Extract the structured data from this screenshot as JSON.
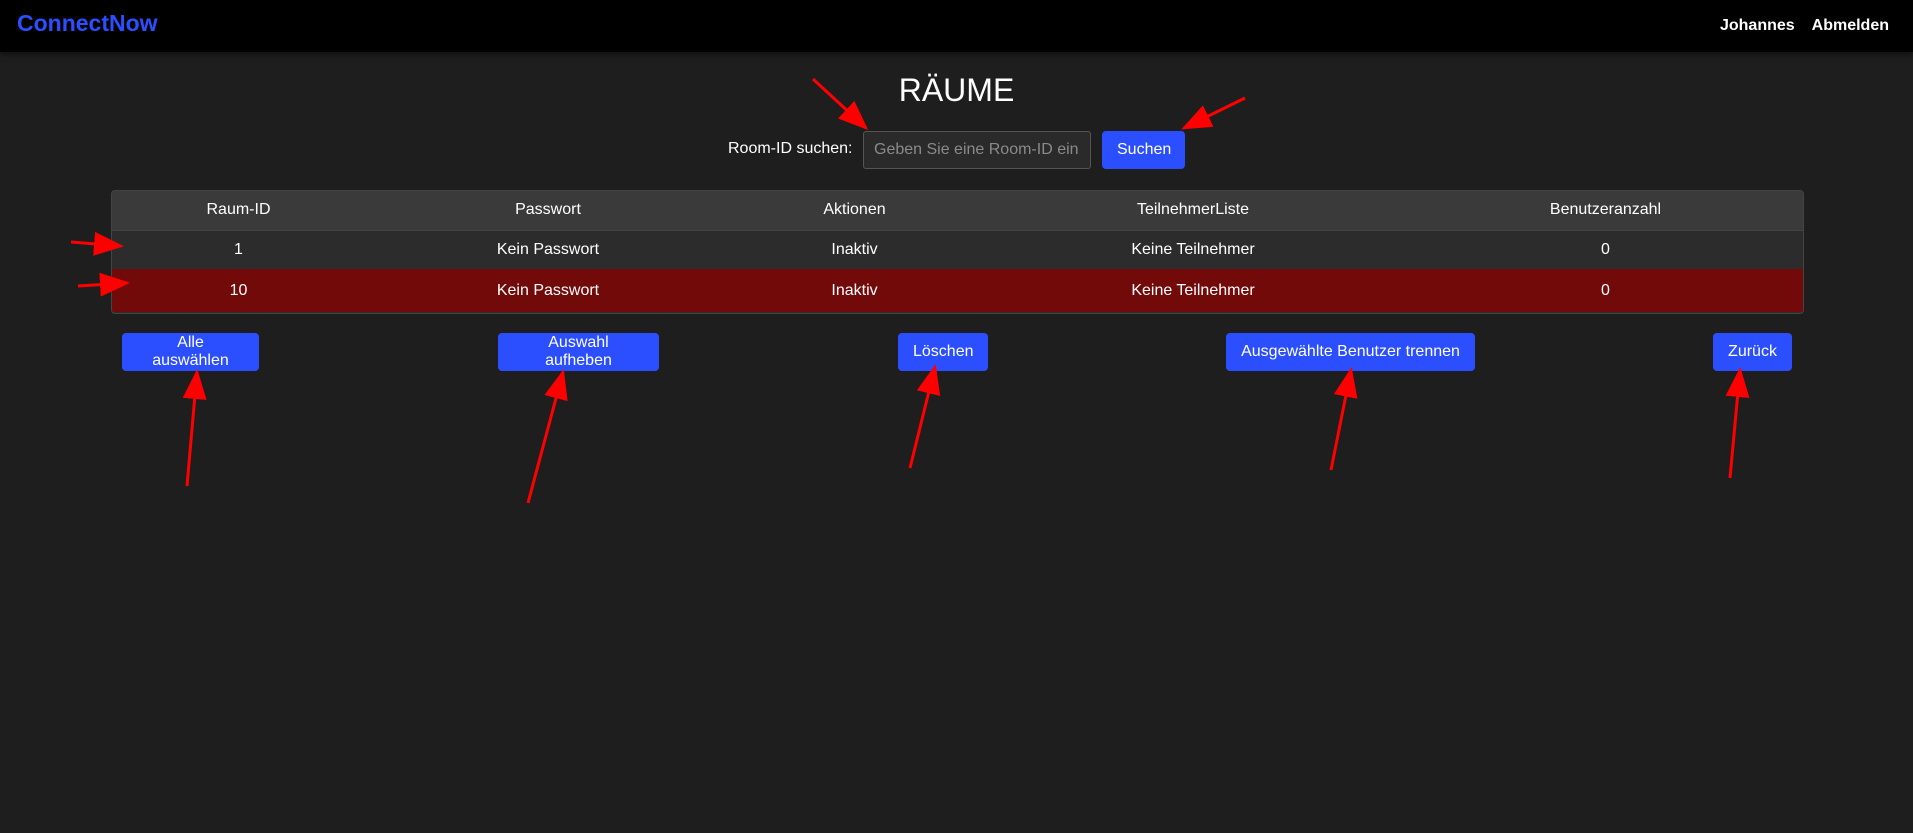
{
  "navbar": {
    "brand": "ConnectNow",
    "user": "Johannes",
    "logout": "Abmelden"
  },
  "page": {
    "title": "RÄUME"
  },
  "search": {
    "label": "Room-ID suchen:",
    "placeholder": "Geben Sie eine Room-ID ein.",
    "value": "",
    "button": "Suchen"
  },
  "table": {
    "headers": [
      "Raum-ID",
      "Passwort",
      "Aktionen",
      "TeilnehmerListe",
      "Benutzeranzahl"
    ],
    "rows": [
      {
        "id": "1",
        "password": "Kein Passwort",
        "action": "Inaktiv",
        "participants": "Keine Teilnehmer",
        "count": "0",
        "selected": false
      },
      {
        "id": "10",
        "password": "Kein Passwort",
        "action": "Inaktiv",
        "participants": "Keine Teilnehmer",
        "count": "0",
        "selected": true
      }
    ]
  },
  "actions": {
    "select_all": "Alle auswählen",
    "deselect": "Auswahl aufheben",
    "delete": "Löschen",
    "disconnect": "Ausgewählte Benutzer trennen",
    "back": "Zurück"
  },
  "colors": {
    "accent": "#2b4fff",
    "selected_row": "#720a0a",
    "annotation_arrow": "#ff0000",
    "background": "#1e1e1e"
  }
}
